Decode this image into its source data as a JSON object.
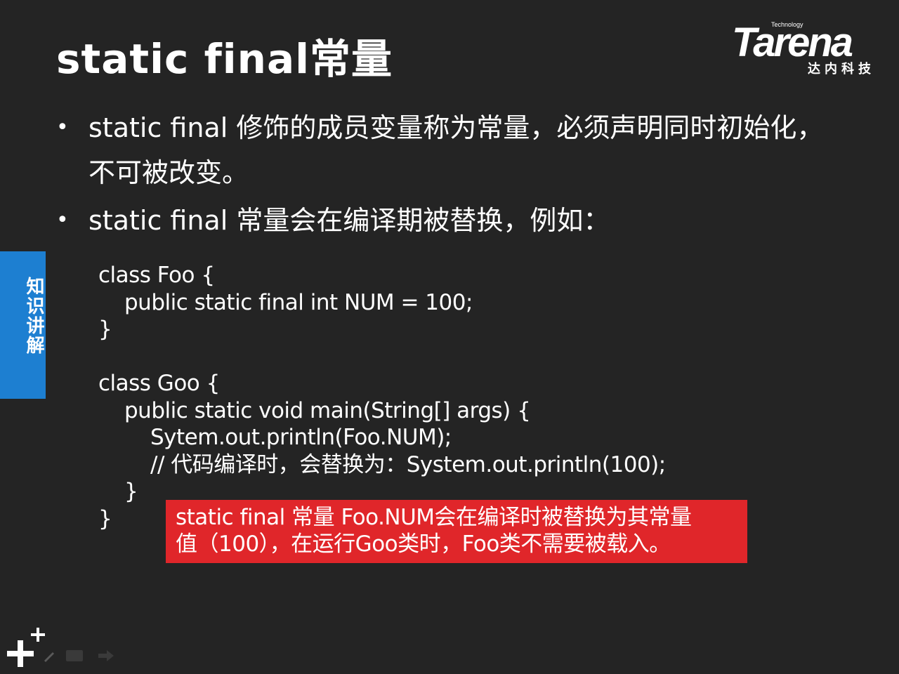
{
  "slide": {
    "title": "static  final常量"
  },
  "logo": {
    "small_text": "Technology",
    "word": "Tarena",
    "cn_text": "达内科技"
  },
  "bullets": [
    {
      "marker": "•",
      "text": "static final 修饰的成员变量称为常量，必须声明同时初始化，不可被改变。"
    },
    {
      "marker": "•",
      "text": "static final 常量会在编译期被替换，例如："
    }
  ],
  "side_tab": {
    "label": "知识讲解"
  },
  "code": {
    "lines": [
      "class Foo {",
      "public static final int NUM = 100;",
      "}",
      "",
      "class Goo {",
      "public static void main(String[] args) {",
      "Sytem.out.println(Foo.NUM);",
      "// 代码编译时，会替换为：System.out.println(100);",
      "}",
      "}"
    ]
  },
  "callout": {
    "line1": "static final 常量 Foo.NUM会在编译时被替换为其常量",
    "line2": "值（100），在运行Goo类时，Foo类不需要被载入。",
    "background_color": "#e0262a"
  },
  "colors": {
    "background": "#242424",
    "text": "#ffffff",
    "tab_blue": "#1d7fd1"
  }
}
